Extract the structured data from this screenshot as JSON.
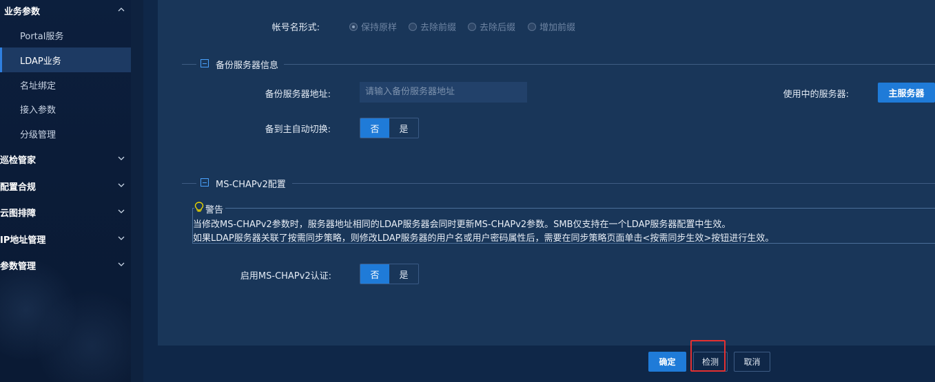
{
  "sidebar": {
    "groups": [
      {
        "label": "业务参数",
        "expanded": true
      },
      {
        "label": "巡检管家"
      },
      {
        "label": "配置合规"
      },
      {
        "label": "云图排障"
      },
      {
        "label": "IP地址管理"
      },
      {
        "label": "参数管理"
      }
    ],
    "items": [
      {
        "label": "Portal服务"
      },
      {
        "label": "LDAP业务",
        "active": true
      },
      {
        "label": "名址绑定"
      },
      {
        "label": "接入参数"
      },
      {
        "label": "分级管理"
      }
    ]
  },
  "account_format": {
    "label": "帐号名形式:",
    "options": [
      "保持原样",
      "去除前缀",
      "去除后缀",
      "增加前缀"
    ],
    "selected": "保持原样"
  },
  "backup_section": {
    "title": "备份服务器信息",
    "address_label": "备份服务器地址:",
    "address_placeholder": "请输入备份服务器地址",
    "server_in_use_label": "使用中的服务器:",
    "server_in_use_value": "主服务器",
    "auto_switch_label": "备到主自动切换:",
    "auto_switch_options": [
      "否",
      "是"
    ],
    "auto_switch_selected": "否"
  },
  "mschap_section": {
    "title": "MS-CHAPv2配置",
    "warning_title": "警告",
    "warning_line1": "当修改MS-CHAPv2参数时，服务器地址相同的LDAP服务器会同时更新MS-CHAPv2参数。SMB仅支持在一个LDAP服务器配置中生效。",
    "warning_line2": "如果LDAP服务器关联了按需同步策略，则修改LDAP服务器的用户名或用户密码属性后，需要在同步策略页面单击<按需同步生效>按钮进行生效。",
    "enable_label": "启用MS-CHAPv2认证:",
    "enable_options": [
      "否",
      "是"
    ],
    "enable_selected": "否"
  },
  "footer": {
    "ok": "确定",
    "test": "检测",
    "cancel": "取消"
  },
  "colors": {
    "accent": "#1f7bd8",
    "highlight": "#e53030",
    "warning_icon": "#e8d400"
  }
}
